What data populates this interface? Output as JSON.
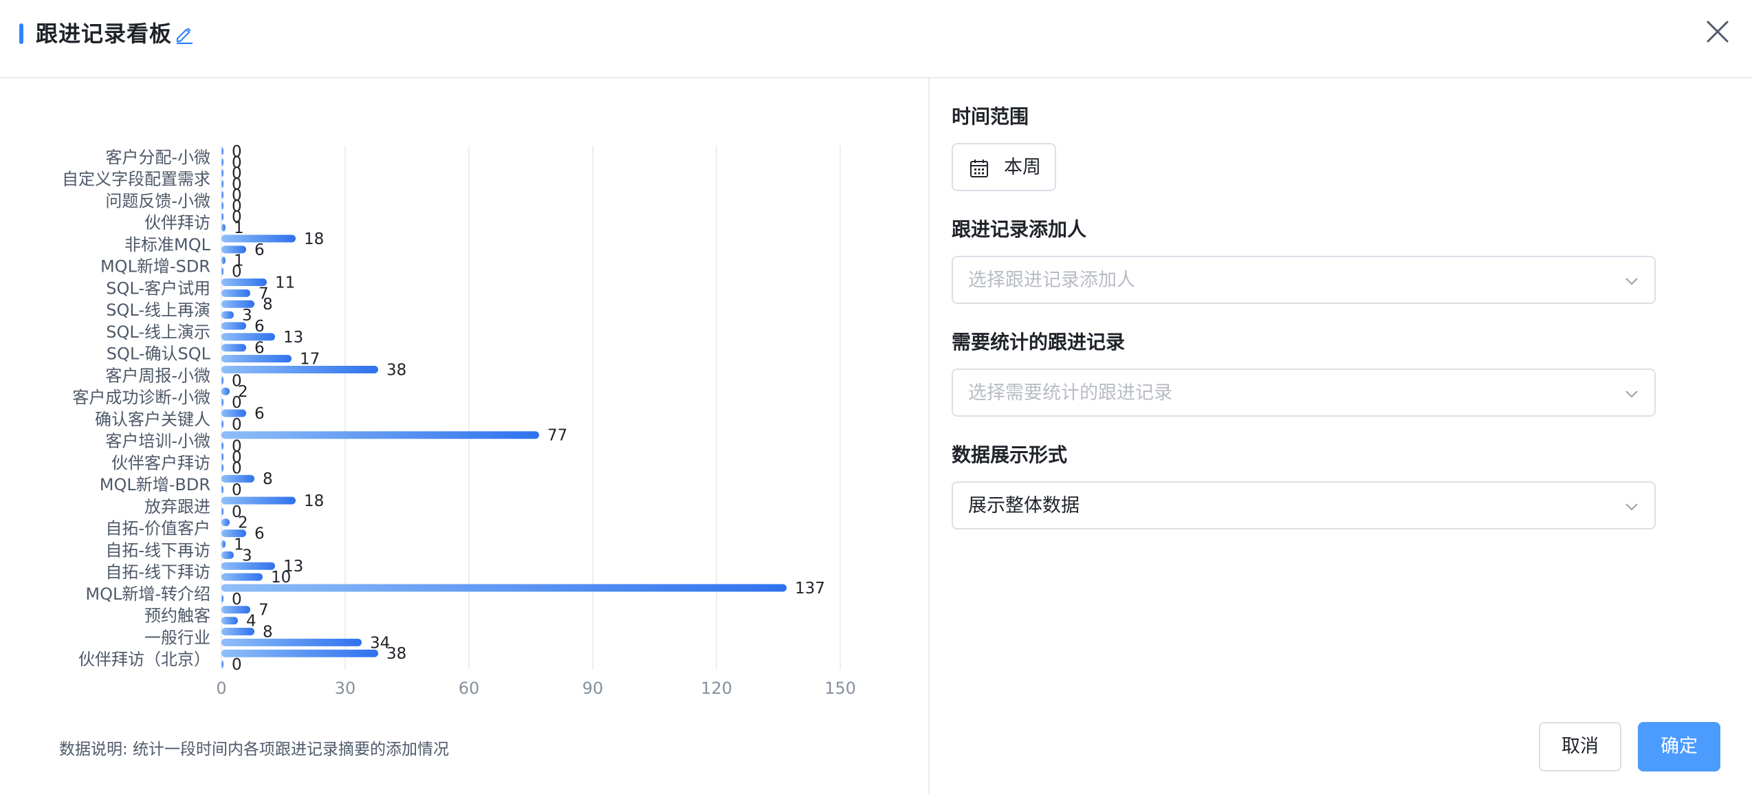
{
  "header": {
    "title": "跟进记录看板"
  },
  "icons": {
    "edit": "edit-pencil-icon",
    "close": "close-icon",
    "calendar": "calendar-icon",
    "chevron": "chevron-down-icon"
  },
  "colors": {
    "accent": "#2f82ff",
    "bar_start": "#8fbef8",
    "bar_end": "#2f72ee",
    "primary_button": "#4c9bff"
  },
  "chart_data": {
    "type": "bar",
    "orientation": "horizontal",
    "categories": [
      "客户分配-小微",
      "自定义字段配置需求",
      "问题反馈-小微",
      "伙伴拜访",
      "非标准MQL",
      "MQL新增-SDR",
      "SQL-客户试用",
      "SQL-线上再演",
      "SQL-线上演示",
      "SQL-确认SQL",
      "客户周报-小微",
      "客户成功诊断-小微",
      "确认客户关键人",
      "客户培训-小微",
      "伙伴客户拜访",
      "MQL新增-BDR",
      "放弃跟进",
      "自拓-价值客户",
      "自拓-线下再访",
      "自拓-线下拜访",
      "MQL新增-转介绍",
      "预约触客",
      "一般行业",
      "伙伴拜访（北京）"
    ],
    "values": [
      0,
      0,
      0,
      0,
      0,
      0,
      0,
      1,
      18,
      6,
      1,
      0,
      11,
      7,
      8,
      3,
      6,
      13,
      6,
      17,
      38,
      0,
      2,
      0,
      6,
      0,
      77,
      0,
      0,
      0,
      8,
      0,
      18,
      0,
      2,
      6,
      1,
      3,
      13,
      10,
      137,
      0,
      7,
      4,
      8,
      34,
      38,
      0
    ],
    "xlim": [
      0,
      150
    ],
    "xticks": [
      0,
      30,
      60,
      90,
      120,
      150
    ],
    "grid": true,
    "data_labels": true
  },
  "note": "数据说明: 统计一段时间内各项跟进记录摘要的添加情况",
  "form": {
    "time_range": {
      "label": "时间范围",
      "value": "本周"
    },
    "adder": {
      "label": "跟进记录添加人",
      "placeholder": "选择跟进记录添加人"
    },
    "records": {
      "label": "需要统计的跟进记录",
      "placeholder": "选择需要统计的跟进记录"
    },
    "display": {
      "label": "数据展示形式",
      "value": "展示整体数据"
    }
  },
  "buttons": {
    "cancel": "取消",
    "ok": "确定"
  }
}
